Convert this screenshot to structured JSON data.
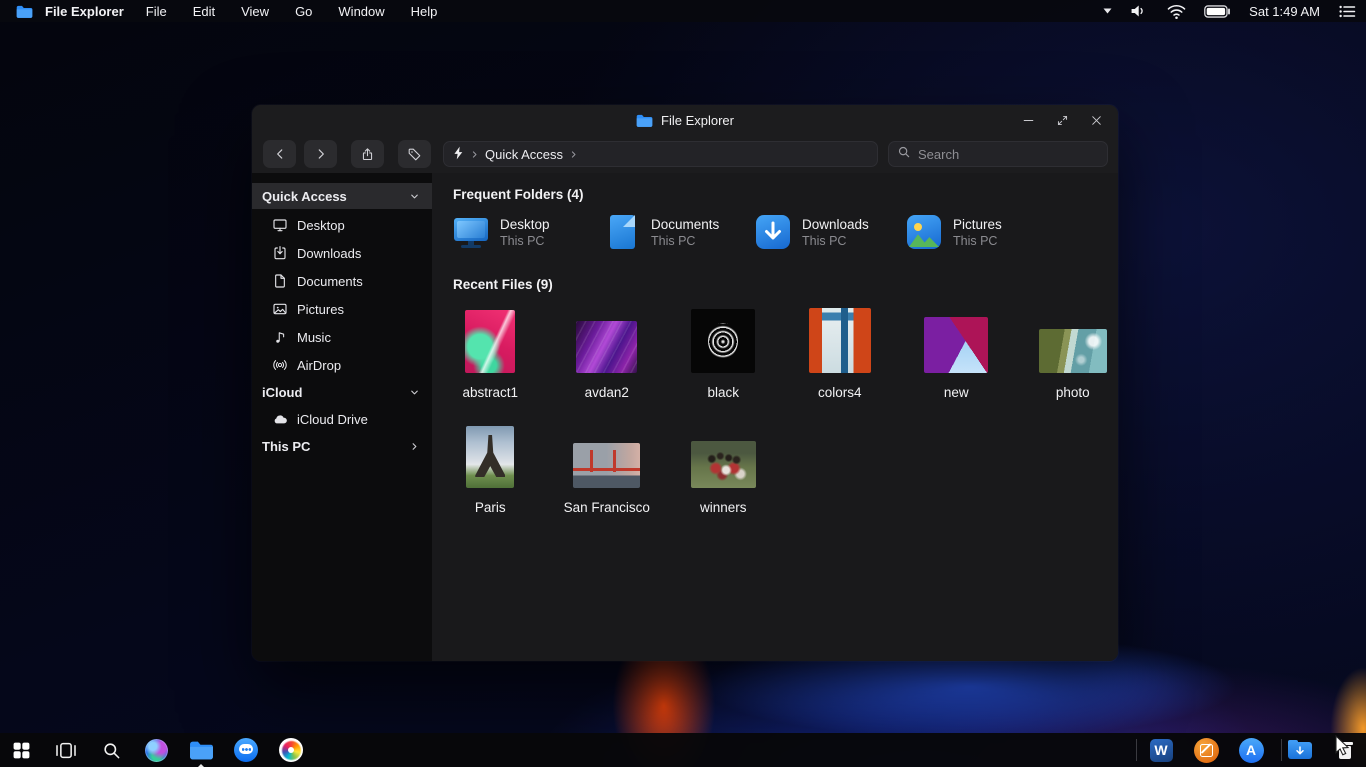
{
  "colors": {
    "accent_blue": "#2e8ef7",
    "window_bg": "#19191b",
    "sidebar_bg": "#0c0c0d",
    "titlebar_bg": "#1c1c1e",
    "selection_bg": "#2a2a2d",
    "secondary_text": "#8b8b90"
  },
  "menu_bar": {
    "app_name": "File Explorer",
    "menus": [
      "File",
      "Edit",
      "View",
      "Go",
      "Window",
      "Help"
    ],
    "clock": "Sat 1:49 AM"
  },
  "window": {
    "title": "File Explorer",
    "breadcrumb_root": "Quick Access",
    "search_placeholder": "Search",
    "sidebar": {
      "sections": [
        {
          "label": "Quick Access",
          "items": [
            {
              "label": "Desktop"
            },
            {
              "label": "Downloads"
            },
            {
              "label": "Documents"
            },
            {
              "label": "Pictures"
            },
            {
              "label": "Music"
            },
            {
              "label": "AirDrop"
            }
          ]
        },
        {
          "label": "iCloud",
          "items": [
            {
              "label": "iCloud Drive"
            }
          ]
        },
        {
          "label": "This PC",
          "items": []
        }
      ]
    },
    "content": {
      "frequent_heading": "Frequent Folders (4)",
      "frequent_folders": [
        {
          "name": "Desktop",
          "location": "This PC"
        },
        {
          "name": "Documents",
          "location": "This PC"
        },
        {
          "name": "Downloads",
          "location": "This PC"
        },
        {
          "name": "Pictures",
          "location": "This PC"
        }
      ],
      "recent_heading": "Recent Files (9)",
      "recent_files": [
        {
          "name": "abstract1"
        },
        {
          "name": "avdan2"
        },
        {
          "name": "black"
        },
        {
          "name": "colors4"
        },
        {
          "name": "new"
        },
        {
          "name": "photo"
        },
        {
          "name": "Paris"
        },
        {
          "name": "San Francisco"
        },
        {
          "name": "winners"
        }
      ]
    }
  },
  "taskbar": {
    "left_icons": [
      "windows-start",
      "task-view",
      "search",
      "siri",
      "file-explorer",
      "messages",
      "photos"
    ],
    "right_icons": [
      "word",
      "compose",
      "app-store",
      "downloads-folder",
      "recycle-bin"
    ],
    "word_letter": "W",
    "appstore_letter": "A"
  }
}
